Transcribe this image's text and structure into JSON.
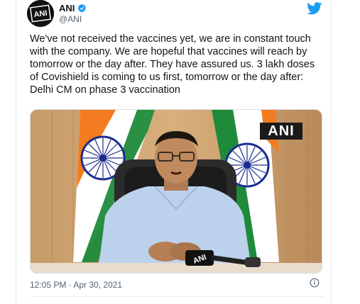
{
  "account": {
    "name": "ANI",
    "handle": "@ANI",
    "avatar_text": "ANI"
  },
  "tweet": {
    "text": "We've not received the vaccines yet, we are in constant touch with the company. We are hopeful that vaccines will reach by tomorrow or the day after. They have assured us. 3 lakh doses of Covishield is coming to us first, tomorrow or the day after: Delhi CM on phase 3 vaccination",
    "timestamp": "12:05 PM · Apr 30, 2021"
  },
  "media": {
    "watermark": "ANI",
    "mic_text": "ANI"
  },
  "colors": {
    "twitter_blue": "#1d9bf0",
    "saffron": "#f47c20",
    "india_green": "#1e8a3a",
    "chakra_blue": "#1a2b8f"
  },
  "icons": {
    "verified": "verified-badge-icon",
    "twitter": "twitter-bird-icon",
    "info": "info-icon"
  }
}
